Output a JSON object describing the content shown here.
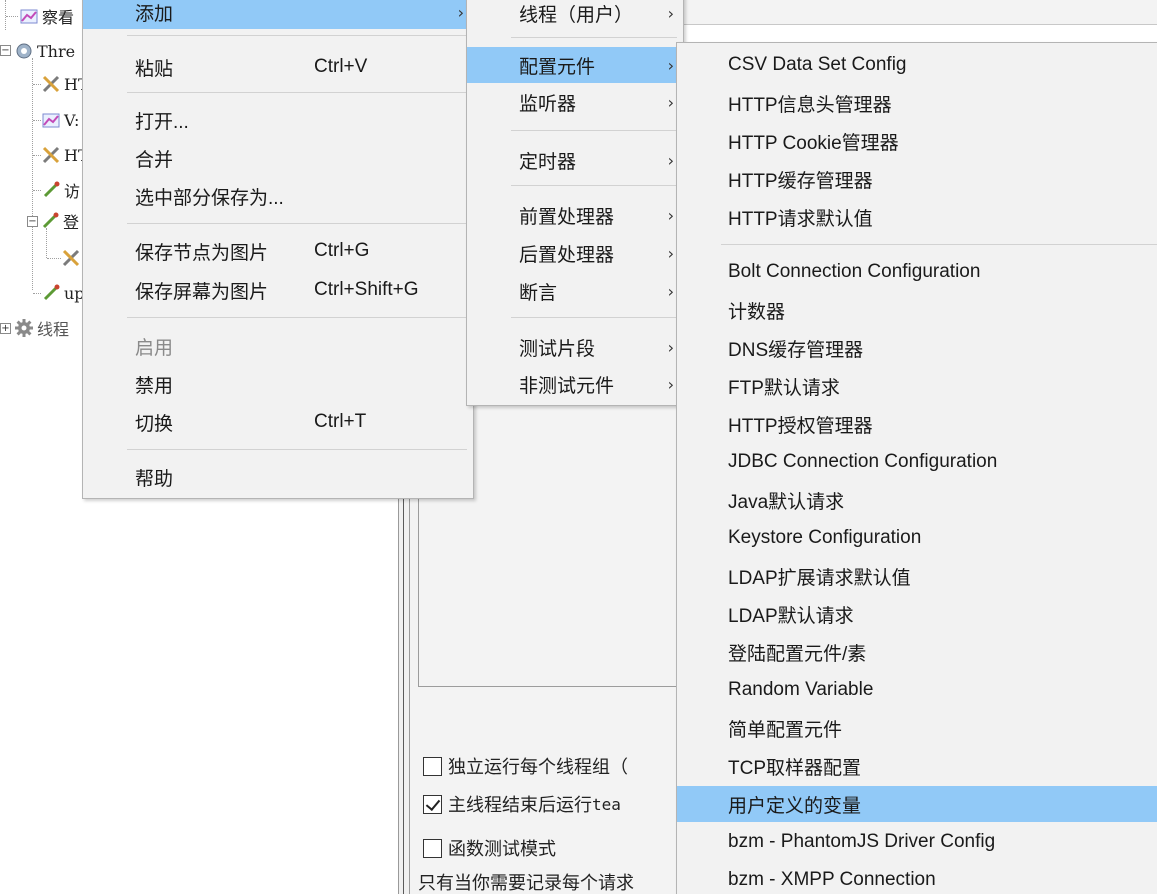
{
  "tree": {
    "nodes": [
      {
        "label": "察看",
        "icon": "listener-icon"
      },
      {
        "label": "Thre",
        "icon": "thread-group-icon"
      },
      {
        "label": "HT",
        "icon": "config-icon"
      },
      {
        "label": "V:",
        "icon": "listener-icon"
      },
      {
        "label": "HT",
        "icon": "config-icon"
      },
      {
        "label": "访",
        "icon": "sampler-icon"
      },
      {
        "label": "登",
        "icon": "sampler-icon"
      },
      {
        "label": "",
        "icon": "config-icon"
      },
      {
        "label": "up",
        "icon": "sampler-icon"
      },
      {
        "label": "线程",
        "icon": "gear-icon"
      }
    ]
  },
  "context_menu": {
    "items": [
      {
        "label": "添加",
        "shortcut": "",
        "submenu": true,
        "highlighted": true
      },
      {
        "label": "粘贴",
        "shortcut": "Ctrl+V"
      },
      {
        "label": "打开..."
      },
      {
        "label": "合并"
      },
      {
        "label": "选中部分保存为..."
      },
      {
        "label": "保存节点为图片",
        "shortcut": "Ctrl+G"
      },
      {
        "label": "保存屏幕为图片",
        "shortcut": "Ctrl+Shift+G"
      },
      {
        "label": "启用",
        "disabled": true
      },
      {
        "label": "禁用"
      },
      {
        "label": "切换",
        "shortcut": "Ctrl+T"
      },
      {
        "label": "帮助"
      }
    ]
  },
  "add_submenu": {
    "items": [
      {
        "label": "线程（用户）"
      },
      {
        "label": "配置元件",
        "highlighted": true
      },
      {
        "label": "监听器"
      },
      {
        "label": "定时器"
      },
      {
        "label": "前置处理器"
      },
      {
        "label": "后置处理器"
      },
      {
        "label": "断言"
      },
      {
        "label": "测试片段"
      },
      {
        "label": "非测试元件"
      }
    ]
  },
  "config_submenu": {
    "items": [
      "CSV Data Set Config",
      "HTTP信息头管理器",
      "HTTP Cookie管理器",
      "HTTP缓存管理器",
      "HTTP请求默认值",
      "Bolt Connection Configuration",
      "计数器",
      "DNS缓存管理器",
      "FTP默认请求",
      "HTTP授权管理器",
      "JDBC Connection Configuration",
      "Java默认请求",
      "Keystore Configuration",
      "LDAP扩展请求默认值",
      "LDAP默认请求",
      "登陆配置元件/素",
      "Random Variable",
      "简单配置元件",
      "TCP取样器配置",
      "用户定义的变量",
      "bzm - PhantomJS Driver Config",
      "bzm - XMPP Connection"
    ],
    "highlighted_index": 19
  },
  "options": {
    "run_each_group": "独立运行每个线程组（",
    "teardown_prefix": "主线程结束后运行 ",
    "teardown_mono": "tea",
    "functional_mode": "函数测试模式",
    "note": "只有当你需要记录每个请求"
  },
  "colors": {
    "highlight": "#91c9f7",
    "menu_bg": "#f2f2f2"
  }
}
